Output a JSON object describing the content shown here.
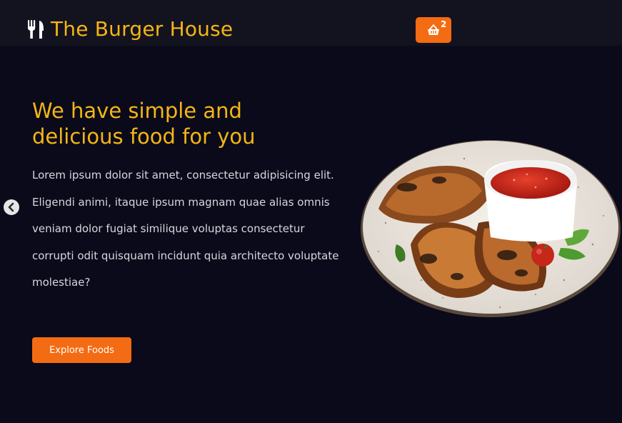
{
  "brand": {
    "name": "The Burger House",
    "icon": "fork-knife-icon"
  },
  "cart": {
    "count": "2",
    "icon": "basket-icon"
  },
  "slider": {
    "prev_icon": "chevron-left-icon"
  },
  "hero": {
    "headline": "We have simple and delicious food for you",
    "description": "Lorem ipsum dolor sit amet, consectetur adipisicing elit. Eligendi animi, itaque ipsum magnam quae alias omnis veniam dolor fugiat similique voluptas consectetur corrupti odit quisquam incidunt quia architecto voluptate molestiae?",
    "cta_label": "Explore Foods"
  },
  "colors": {
    "background": "#0a0a1a",
    "navbar": "#13131f",
    "accent_yellow": "#f5b515",
    "accent_orange": "#f36b12"
  }
}
